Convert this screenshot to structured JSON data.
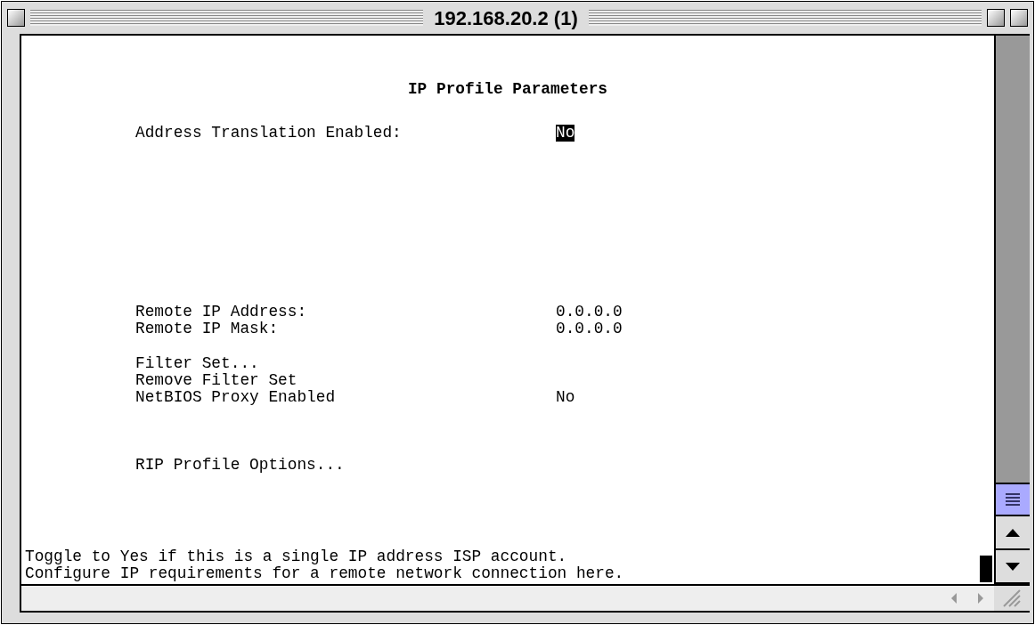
{
  "window": {
    "title": "192.168.20.2 (1)"
  },
  "screen": {
    "heading": "IP Profile Parameters",
    "groups": [
      [
        {
          "label": "Address Translation Enabled:",
          "value": "No",
          "selected": true
        }
      ],
      [
        {
          "label": "Remote IP Address:",
          "value": "0.0.0.0",
          "selected": false
        },
        {
          "label": "Remote IP Mask:",
          "value": "0.0.0.0",
          "selected": false
        }
      ],
      [
        {
          "label": "Filter Set...",
          "selected": false
        },
        {
          "label": "Remove Filter Set",
          "selected": false
        },
        {
          "label": "NetBIOS Proxy Enabled",
          "value": "No",
          "selected": false
        }
      ],
      [
        {
          "label": "RIP Profile Options...",
          "selected": false
        }
      ]
    ],
    "help_lines": [
      "Toggle to Yes if this is a single IP address ISP account.",
      "Configure IP requirements for a remote network connection here."
    ]
  }
}
